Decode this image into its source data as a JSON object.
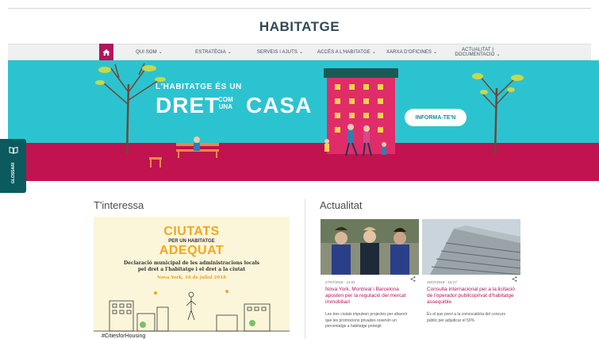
{
  "brand": "HABITATGE",
  "nav": {
    "home_icon": "home-icon",
    "items": [
      {
        "label": "QUI SOM"
      },
      {
        "label": "ESTRATÈGIA"
      },
      {
        "label": "SERVEIS I AJUTS"
      },
      {
        "label": "ACCÉS A L'HABITATGE"
      },
      {
        "label": "XARXA D'OFICINES"
      },
      {
        "label_line1": "ACTUALITAT I",
        "label_line2": "DOCUMENTACIÓ"
      }
    ]
  },
  "hero": {
    "line1": "L'HABITATGE ÉS UN",
    "word_dret": "DRET",
    "small_com": "COM",
    "small_una": "UNA",
    "word_casa": "CASA",
    "cta_label": "INFORMA-TE'N",
    "colors": {
      "sky": "#2cc3d0",
      "ground": "#c0134f",
      "building": "#e02d6a",
      "roof": "#1a5a55"
    }
  },
  "glossari": {
    "label": "GLOSSARI",
    "icon": "book-icon"
  },
  "sections": {
    "interessa": "T'interessa",
    "actualitat": "Actualitat"
  },
  "interessa_card": {
    "line1": "CIUTATS",
    "line2": "PER UN HABITATGE",
    "line3": "ADEQUAT",
    "decl_line1": "Declaració municipal de les administracions locals",
    "decl_line2": "pel dret a l'habitatge i el dret a la ciutat",
    "date": "Nova York, 16 de juliol 2018",
    "hashtag": "#CitiesforHousing"
  },
  "news": [
    {
      "meta": "27/07/2018 - 14:01",
      "headline": "Nova York, Montreal i Barcelona aposten per la regulació del mercat immobiliari",
      "excerpt": "Les tres ciutats impulsen projectes per afavorir que les promocions privades reservin un percentatge a habitatge protegit"
    },
    {
      "meta": "25/07/2018 - 16:17",
      "headline": "Consulta internacional per a la licitació de l'operador publicoprivat d'habitatge assequible",
      "excerpt": "És el pas previ a la convocatòria del concurs públic per adjudicar el 50%"
    }
  ]
}
